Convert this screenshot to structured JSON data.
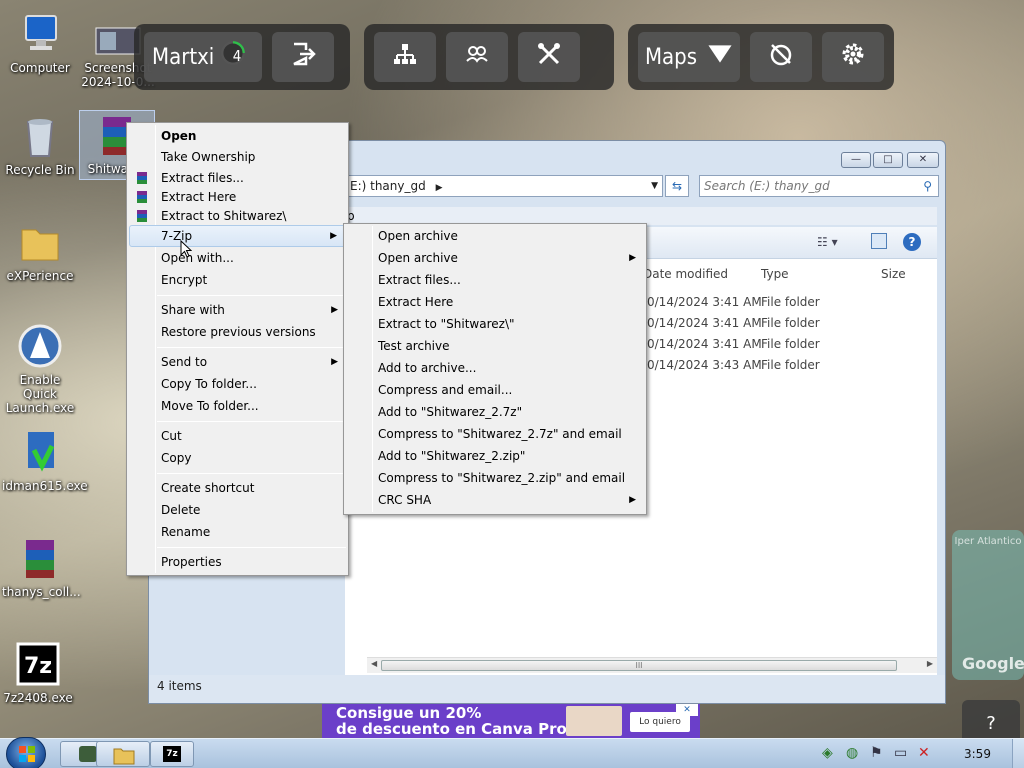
{
  "desktop_icons": [
    {
      "label": "Computer",
      "icon": "computer-icon"
    },
    {
      "label": "Screenshot 2024-10-0...",
      "icon": "screenshot-thumbnail-icon"
    },
    {
      "label": "Recycle Bin",
      "icon": "recycle-bin-icon"
    },
    {
      "label": "Shitwarez",
      "icon": "winrar-archive-icon"
    },
    {
      "label": "eXPerience",
      "icon": "folder-icon"
    },
    {
      "label": "Enable Quick Launch.exe",
      "icon": "launcher-icon"
    },
    {
      "label": "idman615.exe",
      "icon": "installer-icon"
    },
    {
      "label": "thanys_coll...",
      "icon": "winrar-archive-icon"
    },
    {
      "label": "7z2408.exe",
      "icon": "7zip-icon"
    }
  ],
  "toolbar": {
    "user": "Martxi",
    "badge": "4",
    "maps_label": "Maps",
    "icons": [
      "exit-icon",
      "hierarchy-icon",
      "group-icon",
      "crossed-tools-icon",
      "chevron-down-icon",
      "no-timer-icon",
      "gear-icon"
    ]
  },
  "explorer": {
    "address": "E:) thany_gd",
    "address_fragment": "p",
    "search_placeholder": "Search (E:) thany_gd",
    "columns": [
      "Date modified",
      "Type",
      "Size"
    ],
    "rows": [
      {
        "date": "0/14/2024 3:41 AM",
        "type": "File folder"
      },
      {
        "date": "0/14/2024 3:41 AM",
        "type": "File folder"
      },
      {
        "date": "0/14/2024 3:41 AM",
        "type": "File folder"
      },
      {
        "date": "0/14/2024 3:43 AM",
        "type": "File folder"
      }
    ],
    "status": "4 items",
    "scroll_grip": "III"
  },
  "context_menu": {
    "items": [
      {
        "label": "Open",
        "bold": true
      },
      {
        "label": "Take Ownership"
      },
      {
        "label": "Extract files...",
        "icon": "winrar-icon"
      },
      {
        "label": "Extract Here",
        "icon": "winrar-icon"
      },
      {
        "label": "Extract to Shitwarez\\",
        "icon": "winrar-icon"
      },
      {
        "label": "7-Zip",
        "submenu": true,
        "highlighted": true
      },
      {
        "label": "Open with..."
      },
      {
        "label": "Encrypt"
      },
      {
        "label": "Share with",
        "submenu": true
      },
      {
        "label": "Restore previous versions"
      },
      {
        "label": "Send to",
        "submenu": true
      },
      {
        "label": "Copy To folder..."
      },
      {
        "label": "Move To folder..."
      },
      {
        "label": "Cut"
      },
      {
        "label": "Copy"
      },
      {
        "label": "Create shortcut"
      },
      {
        "label": "Delete"
      },
      {
        "label": "Rename"
      },
      {
        "label": "Properties"
      }
    ]
  },
  "zip_submenu": {
    "items": [
      {
        "label": "Open archive"
      },
      {
        "label": "Open archive",
        "submenu": true
      },
      {
        "label": "Extract files..."
      },
      {
        "label": "Extract Here"
      },
      {
        "label": "Extract to \"Shitwarez\\\""
      },
      {
        "label": "Test archive"
      },
      {
        "label": "Add to archive..."
      },
      {
        "label": "Compress and email..."
      },
      {
        "label": "Add to \"Shitwarez_2.7z\""
      },
      {
        "label": "Compress to \"Shitwarez_2.7z\" and email"
      },
      {
        "label": "Add to \"Shitwarez_2.zip\""
      },
      {
        "label": "Compress to \"Shitwarez_2.zip\" and email"
      },
      {
        "label": "CRC SHA",
        "submenu": true
      }
    ]
  },
  "ad": {
    "line1": "Consigue un 20%",
    "line2": "de descuento en Canva Pro",
    "button": "Lo quiero"
  },
  "taskbar": {
    "clock": "3:59",
    "help": "?"
  },
  "watermark": {
    "text": "Iper Atlantico",
    "google": "Google"
  },
  "colors": {
    "toolbar_bg": "#282828",
    "menu_bg": "#f0f0f0",
    "highlight": "#d8e6f6",
    "taskbar": "#b9cfe6",
    "ad": "#6b3fc9"
  }
}
